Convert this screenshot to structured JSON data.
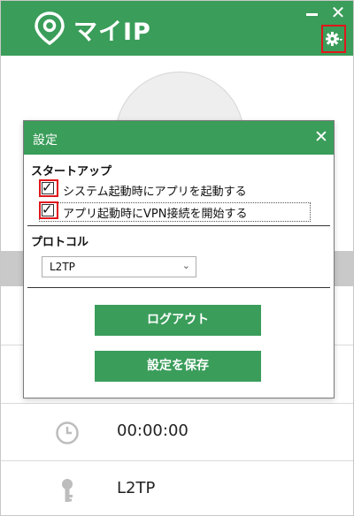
{
  "app": {
    "title": "マイIP",
    "close_glyph": "✕"
  },
  "status": {
    "timer": "00:00:00",
    "protocol": "L2TP"
  },
  "dialog": {
    "title": "設定",
    "close_glyph": "✕",
    "startup": {
      "label": "スタートアップ",
      "options": [
        {
          "label": "システム起動時にアプリを起動する",
          "checked": true
        },
        {
          "label": "アプリ起動時にVPN接続を開始する",
          "checked": true
        }
      ]
    },
    "protocol": {
      "label": "プロトコル",
      "selected": "L2TP"
    },
    "buttons": {
      "logout": "ログアウト",
      "save": "設定を保存"
    }
  },
  "colors": {
    "brand_green": "#3a9d5a",
    "highlight_red": "#e0161b"
  },
  "icons": [
    "location-pin-icon",
    "minimize-icon",
    "close-icon",
    "gear-icon",
    "clock-icon",
    "key-icon",
    "chevron-down-icon"
  ]
}
